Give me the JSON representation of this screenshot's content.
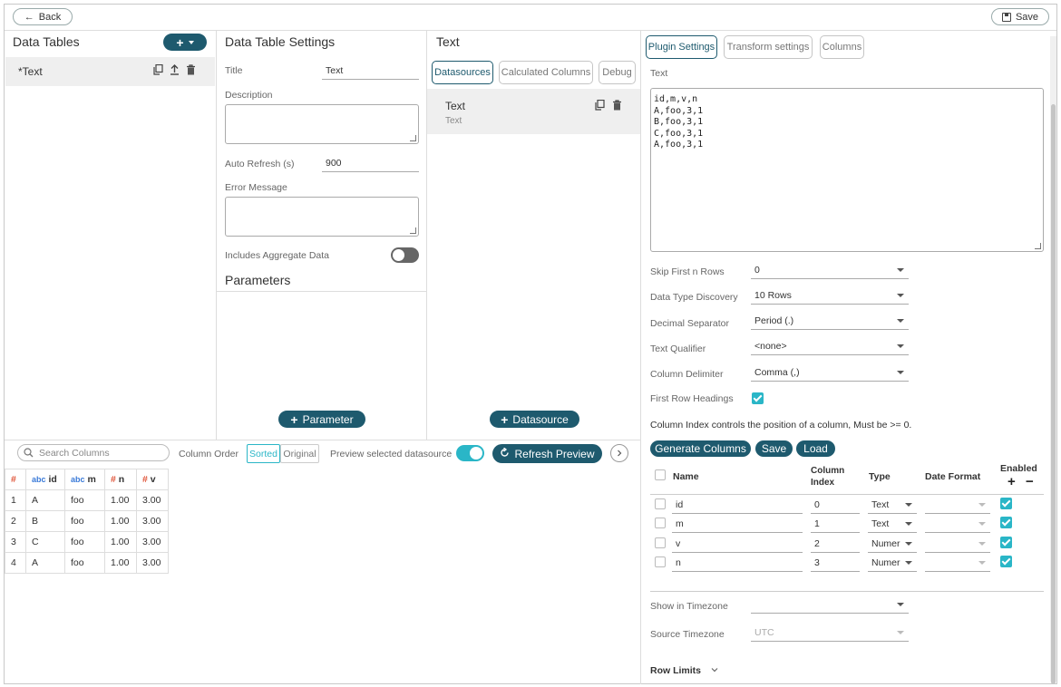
{
  "toolbar": {
    "back_label": "Back",
    "save_label": "Save"
  },
  "data_tables": {
    "title": "Data Tables",
    "add_label": "+",
    "items": [
      {
        "label": "*Text"
      }
    ]
  },
  "settings": {
    "title": "Data Table Settings",
    "title_label": "Title",
    "title_value": "Text",
    "description_label": "Description",
    "auto_refresh_label": "Auto Refresh (s)",
    "auto_refresh_value": "900",
    "error_message_label": "Error Message",
    "aggregate_label": "Includes Aggregate Data",
    "parameters_title": "Parameters",
    "add_parameter_label": "Parameter"
  },
  "datasource_panel": {
    "title": "Text",
    "tabs": [
      "Datasources",
      "Calculated Columns",
      "Debug"
    ],
    "items": [
      {
        "name": "Text",
        "type": "Text"
      }
    ],
    "add_datasource_label": "Datasource"
  },
  "plugin": {
    "tabs": [
      "Plugin Settings",
      "Transform settings",
      "Columns"
    ],
    "text_label": "Text",
    "text_content": "id,m,v,n\nA,foo,3,1\nB,foo,3,1\nC,foo,3,1\nA,foo,3,1",
    "fields": [
      {
        "label": "Skip First n Rows",
        "value": "0"
      },
      {
        "label": "Data Type Discovery",
        "value": "10 Rows"
      },
      {
        "label": "Decimal Separator",
        "value": "Period (.)"
      },
      {
        "label": "Text Qualifier",
        "value": "<none>"
      },
      {
        "label": "Column Delimiter",
        "value": "Comma (,)"
      }
    ],
    "first_row_label": "First Row Headings",
    "column_index_note": "Column Index controls the position of a column, Must be >= 0.",
    "generate_label": "Generate Columns",
    "save_label": "Save",
    "load_label": "Load",
    "col_headers": {
      "name": "Name",
      "index": "Column Index",
      "type": "Type",
      "date_format": "Date Format",
      "enabled": "Enabled"
    },
    "columns": [
      {
        "name": "id",
        "index": "0",
        "type": "Text"
      },
      {
        "name": "m",
        "index": "1",
        "type": "Text"
      },
      {
        "name": "v",
        "index": "2",
        "type": "Numer"
      },
      {
        "name": "n",
        "index": "3",
        "type": "Numer"
      }
    ],
    "show_tz_label": "Show in Timezone",
    "show_tz_value": "",
    "source_tz_label": "Source Timezone",
    "source_tz_value": "UTC",
    "row_limits_label": "Row Limits"
  },
  "preview": {
    "search_placeholder": "Search Columns",
    "column_order_label": "Column Order",
    "sorted_label": "Sorted",
    "original_label": "Original",
    "preview_selected_label": "Preview selected datasource",
    "refresh_label": "Refresh Preview",
    "headers": {
      "row": "#",
      "id": "id",
      "m": "m",
      "n": "n",
      "v": "v",
      "abc": "abc",
      "hash": "#"
    },
    "rows": [
      {
        "r": "1",
        "id": "A",
        "m": "foo",
        "n": "1.00",
        "v": "3.00"
      },
      {
        "r": "2",
        "id": "B",
        "m": "foo",
        "n": "1.00",
        "v": "3.00"
      },
      {
        "r": "3",
        "id": "C",
        "m": "foo",
        "n": "1.00",
        "v": "3.00"
      },
      {
        "r": "4",
        "id": "A",
        "m": "foo",
        "n": "1.00",
        "v": "3.00"
      }
    ]
  }
}
